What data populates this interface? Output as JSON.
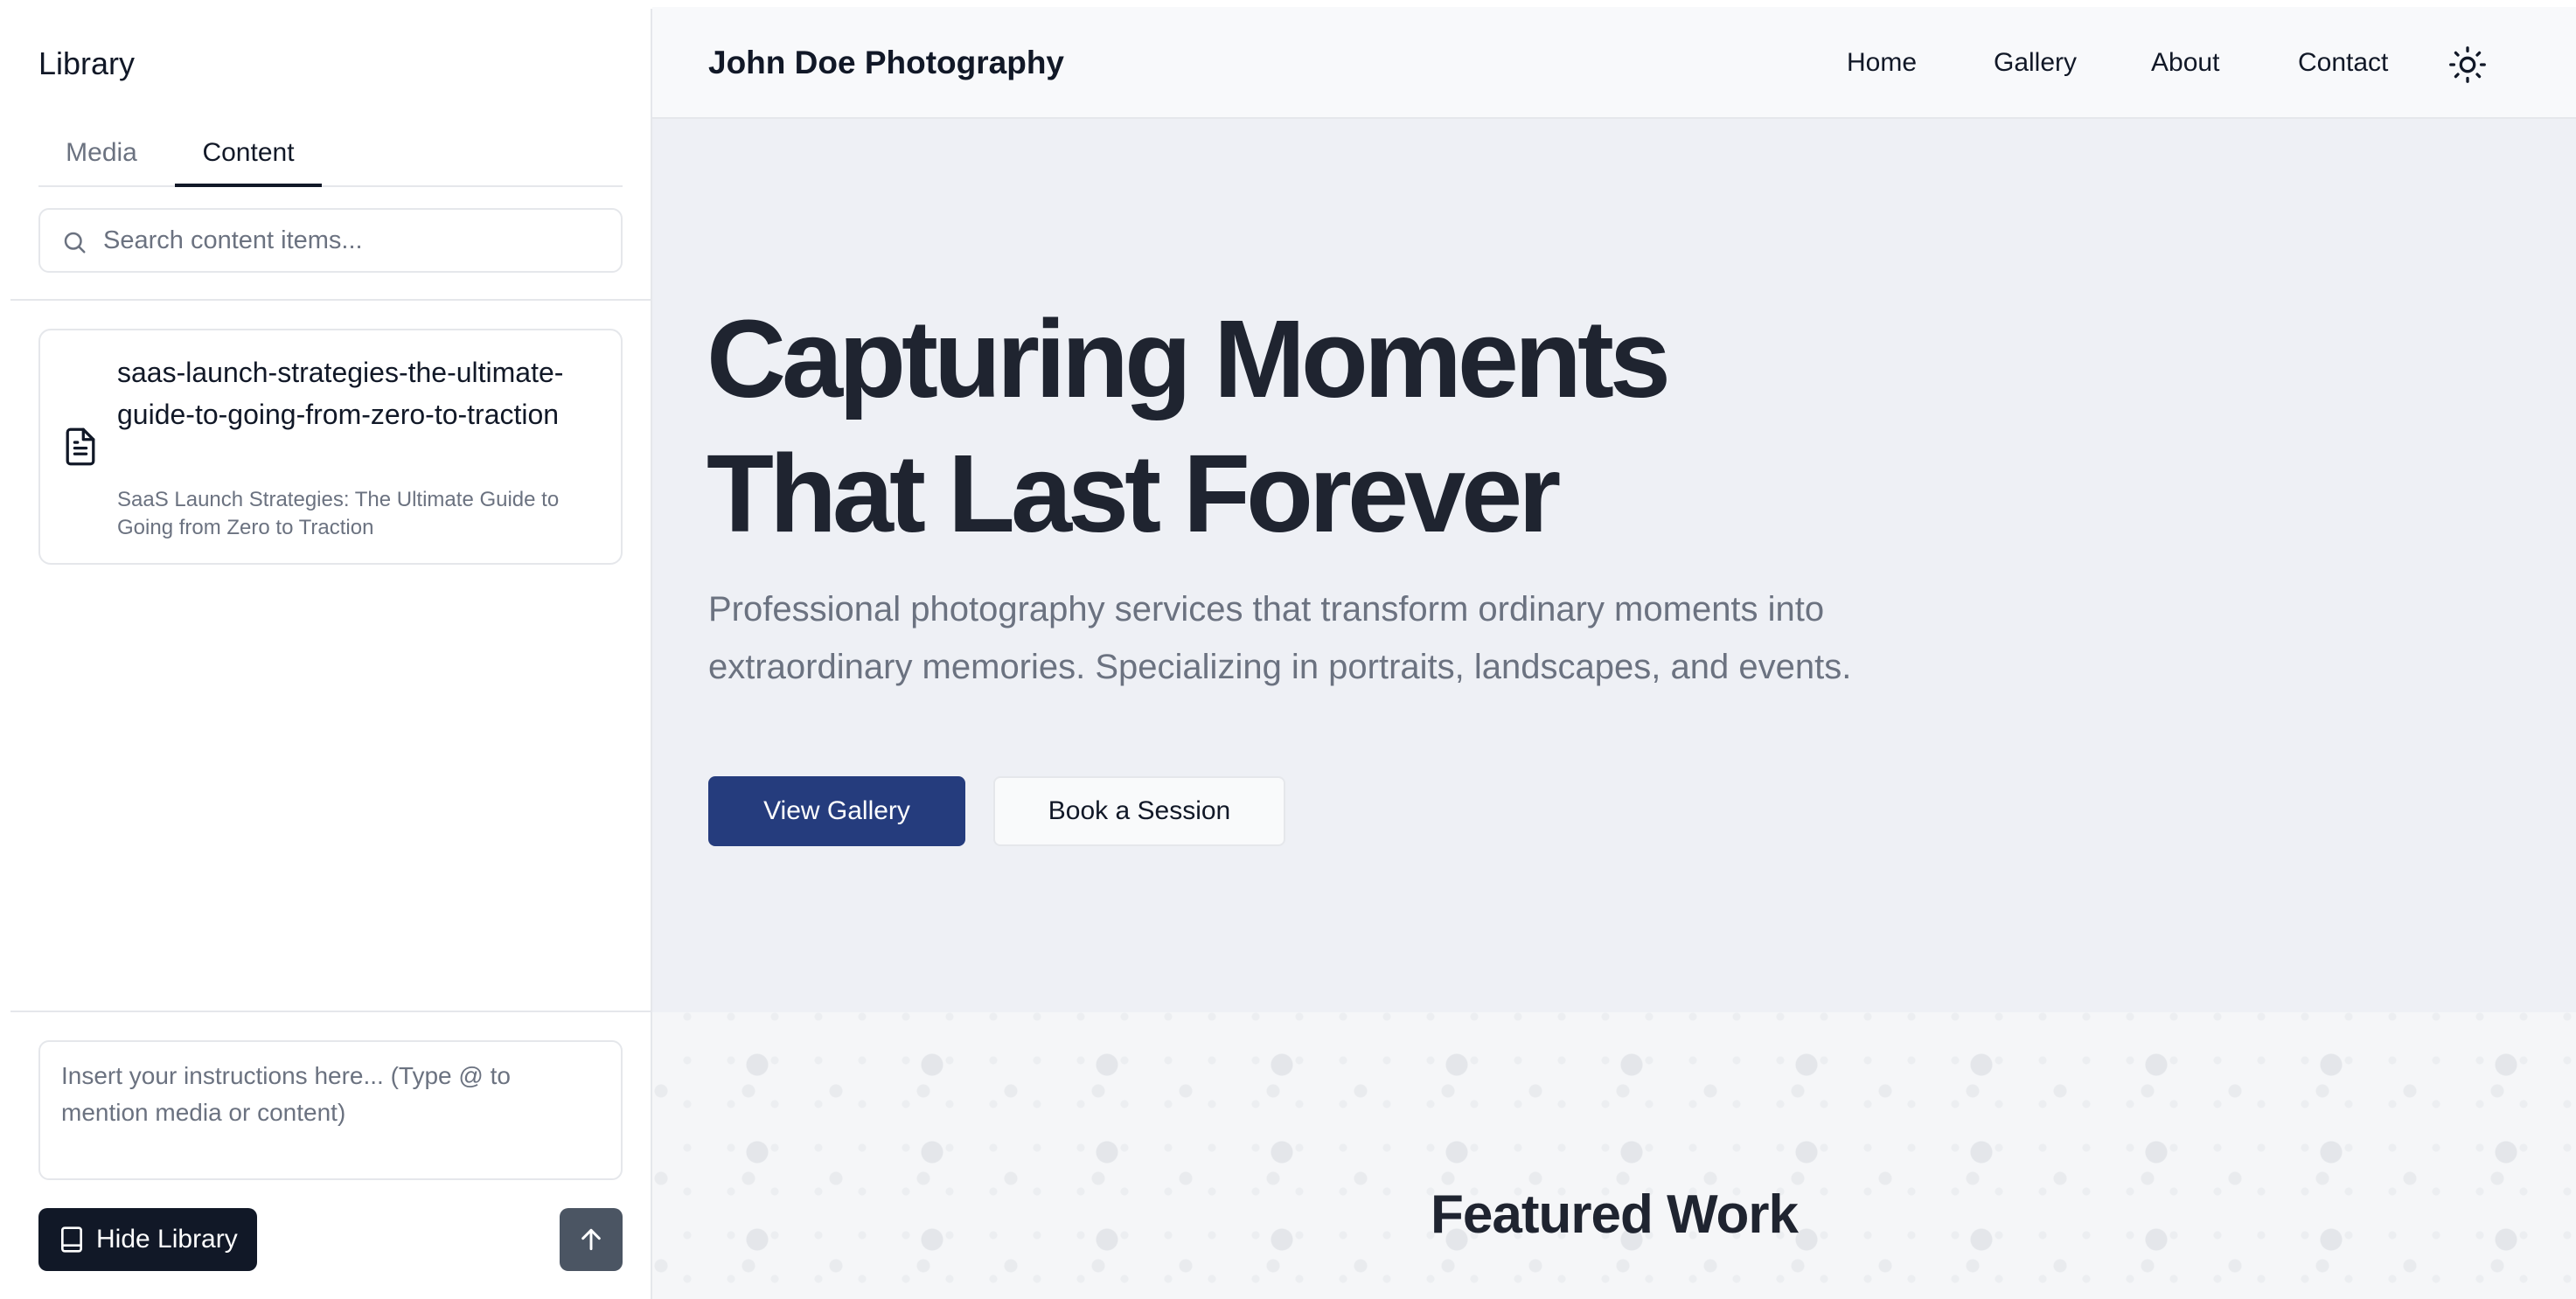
{
  "sidebar": {
    "title": "Library",
    "tabs": [
      {
        "label": "Media",
        "active": false
      },
      {
        "label": "Content",
        "active": true
      }
    ],
    "search": {
      "placeholder": "Search content items...",
      "value": ""
    },
    "items": [
      {
        "icon": "file-text-icon",
        "title": "saas-launch-strategies-the-ultimate-guide-to-going-from-zero-to-traction",
        "subtitle": "SaaS Launch Strategies: The Ultimate Guide to Going from Zero to Traction"
      }
    ],
    "instructions": {
      "placeholder": "Insert your instructions here... (Type @ to mention media or content)",
      "value": ""
    },
    "hide_button": {
      "label": "Hide Library",
      "icon": "book-icon"
    },
    "send_button": {
      "icon": "arrow-up-icon"
    }
  },
  "site": {
    "brand": "John Doe Photography",
    "nav": [
      {
        "label": "Home"
      },
      {
        "label": "Gallery"
      },
      {
        "label": "About"
      },
      {
        "label": "Contact"
      }
    ],
    "theme_toggle_icon": "sun-icon",
    "hero": {
      "title_line1": "Capturing Moments",
      "title_line2": "That Last Forever",
      "subtitle": "Professional photography services that transform ordinary moments into extraordinary memories. Specializing in portraits, landscapes, and events.",
      "primary_button": "View Gallery",
      "secondary_button": "Book a Session"
    },
    "featured": {
      "title": "Featured Work"
    }
  },
  "colors": {
    "primary": "#253c7d",
    "dark": "#111827",
    "muted": "#6b7280",
    "hero_bg": "#eef0f5",
    "border": "#e5e7eb"
  }
}
